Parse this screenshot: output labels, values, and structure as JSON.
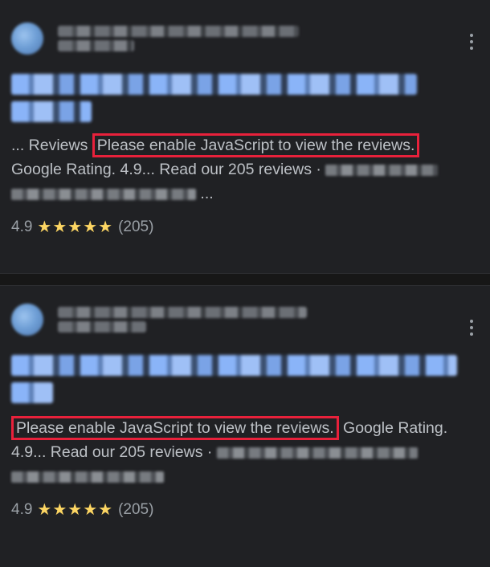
{
  "results": [
    {
      "snippet_prefix": "... Reviews",
      "highlight": "Please enable JavaScript to view the reviews.",
      "snippet_line2": "Google Rating. 4.9... Read our 205 reviews ·",
      "snippet_line3_tail": "...",
      "rating": "4.9",
      "stars": "★★★★★",
      "review_count": "(205)"
    },
    {
      "highlight": "Please enable JavaScript to view the reviews.",
      "snippet_tail": "Google Rating.",
      "snippet_line2": "4.9... Read our 205 reviews ·",
      "rating": "4.9",
      "stars": "★★★★★",
      "review_count": "(205)"
    }
  ],
  "colors": {
    "background": "#202124",
    "highlight_border": "#e8213b",
    "star": "#fdd663",
    "title_link": "#8ab4f8"
  },
  "icons": [
    "site-favicon",
    "more-vert-icon",
    "star-icon"
  ]
}
